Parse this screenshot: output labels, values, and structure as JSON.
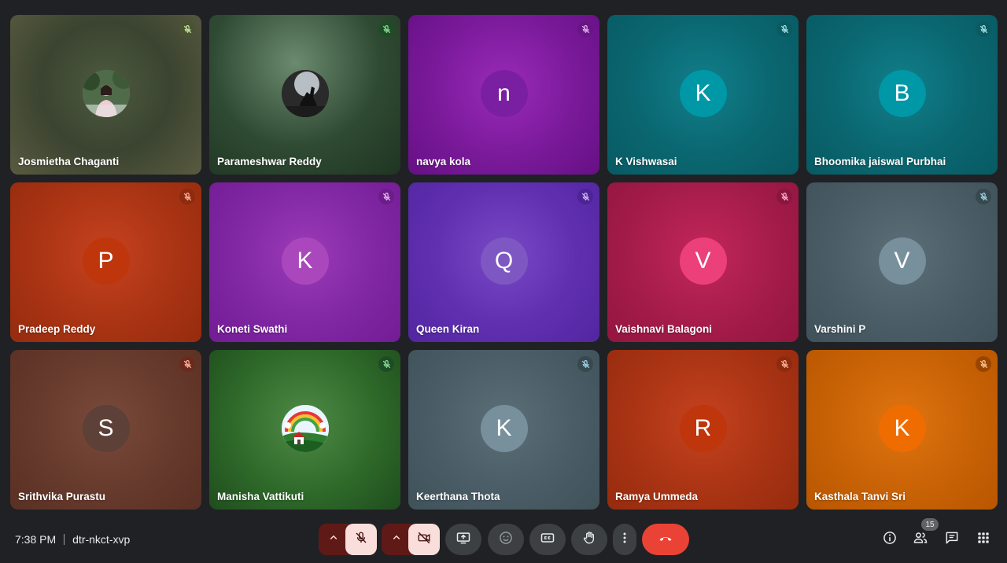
{
  "participants": [
    {
      "name": "Josmietha Chaganti",
      "avatar": "photo-person",
      "initial": "",
      "bg": "radial-gradient(circle at 50% 45%, #4f5a40 0%, #3a4430 50%, #5a5a40 100%)",
      "avatar_bg": "#6b8a6a",
      "badge_bg": "#4a5234",
      "badge_color": "#c9e7a0"
    },
    {
      "name": "Parameshwar Reddy",
      "avatar": "photo-silhouette",
      "initial": "",
      "bg": "radial-gradient(circle at 45% 30%, #6b8a6e 0%, #2f4a33 55%, #1f3522 100%)",
      "avatar_bg": "#333",
      "badge_bg": "#1e4d25",
      "badge_color": "#8fd99b"
    },
    {
      "name": "navya kola",
      "avatar": "letter",
      "initial": "n",
      "bg": "radial-gradient(circle at 50% 45%, #9a2ab8 0%, #7a1a9a 55%, #661085 100%)",
      "avatar_bg": "#7b1fa2",
      "badge_bg": "#6a1585",
      "badge_color": "#e1b6f0"
    },
    {
      "name": "K Vishwasai",
      "avatar": "letter",
      "initial": "K",
      "bg": "radial-gradient(circle at 50% 45%, #117f8a 0%, #0a6670 55%, #085a63 100%)",
      "avatar_bg": "#0097a7",
      "badge_bg": "#0a5a62",
      "badge_color": "#a6e4ec"
    },
    {
      "name": "Bhoomika jaiswal Purbhai",
      "avatar": "letter",
      "initial": "B",
      "bg": "radial-gradient(circle at 50% 45%, #117f8a 0%, #0a6670 55%, #085a63 100%)",
      "avatar_bg": "#0097a7",
      "badge_bg": "#0a5a62",
      "badge_color": "#a6e4ec"
    },
    {
      "name": "Pradeep Reddy",
      "avatar": "letter",
      "initial": "P",
      "bg": "radial-gradient(circle at 50% 45%, #c6421f 0%, #a93414 55%, #962b0e 100%)",
      "avatar_bg": "#bf360c",
      "badge_bg": "#8e2a0d",
      "badge_color": "#ffb59c"
    },
    {
      "name": "Koneti Swathi",
      "avatar": "letter",
      "initial": "K",
      "bg": "radial-gradient(circle at 50% 45%, #9c3bb8 0%, #8027a3 55%, #721c94 100%)",
      "avatar_bg": "#ab47bc",
      "badge_bg": "#6e1c8c",
      "badge_color": "#e6baf2"
    },
    {
      "name": "Queen Kiran",
      "avatar": "letter",
      "initial": "Q",
      "bg": "radial-gradient(circle at 50% 45%, #7a49c6 0%, #5f2fb0 55%, #5226a0 100%)",
      "avatar_bg": "#7e57c2",
      "badge_bg": "#4d2395",
      "badge_color": "#d0bcf7"
    },
    {
      "name": "Vaishnavi Balagoni",
      "avatar": "letter",
      "initial": "V",
      "bg": "radial-gradient(circle at 50% 45%, #c2275a 0%, #a51c4a 55%, #931540 100%)",
      "avatar_bg": "#ec407a",
      "badge_bg": "#8a1640",
      "badge_color": "#ffb1c8"
    },
    {
      "name": "Varshini P",
      "avatar": "letter",
      "initial": "V",
      "bg": "radial-gradient(circle at 50% 45%, #5b6f78 0%, #4a5d66 55%, #3f5159 100%)",
      "avatar_bg": "#78909c",
      "badge_bg": "#37484f",
      "badge_color": "#9fd6ea"
    },
    {
      "name": "Srithvika Purastu",
      "avatar": "letter",
      "initial": "S",
      "bg": "radial-gradient(circle at 50% 45%, #7a4a3a 0%, #663a2c 55%, #5a3024 100%)",
      "avatar_bg": "#5d4037",
      "badge_bg": "#6a2a1e",
      "badge_color": "#ffb59c"
    },
    {
      "name": "Manisha Vattikuti",
      "avatar": "photo-rainbow",
      "initial": "",
      "bg": "radial-gradient(circle at 50% 45%, #4f8a46 0%, #2f6a2a 55%, #1f4d1d 100%)",
      "avatar_bg": "#fff",
      "badge_bg": "#1e4d25",
      "badge_color": "#8fd99b"
    },
    {
      "name": "Keerthana Thota",
      "avatar": "letter",
      "initial": "K",
      "bg": "radial-gradient(circle at 50% 45%, #5b6f78 0%, #4a5d66 55%, #3f5159 100%)",
      "avatar_bg": "#78909c",
      "badge_bg": "#37484f",
      "badge_color": "#9fd6ea"
    },
    {
      "name": "Ramya Ummeda",
      "avatar": "letter",
      "initial": "R",
      "bg": "radial-gradient(circle at 50% 45%, #c6421f 0%, #a93414 55%, #962b0e 100%)",
      "avatar_bg": "#bf360c",
      "badge_bg": "#8e2a0d",
      "badge_color": "#ffb59c"
    },
    {
      "name": "Kasthala Tanvi Sri",
      "avatar": "letter",
      "initial": "K",
      "bg": "radial-gradient(circle at 50% 45%, #e0740f 0%, #c86206 55%, #b85600 100%)",
      "avatar_bg": "#ef6c00",
      "badge_bg": "#994500",
      "badge_color": "#ffc791"
    }
  ],
  "bottom_bar": {
    "time": "7:38 PM",
    "meeting_code": "dtr-nkct-xvp",
    "people_count": "15",
    "colors": {
      "end_call": "#ea4335",
      "muted_bg": "#f9dedc",
      "caret_bg": "#5f1a17",
      "button_bg": "#3c4043"
    },
    "icons": [
      "chevron-up-icon",
      "mic-off-icon",
      "chevron-up-icon",
      "camera-off-icon",
      "present-screen-icon",
      "emoji-icon",
      "captions-icon",
      "raise-hand-icon",
      "more-options-icon",
      "end-call-icon",
      "info-icon",
      "people-icon",
      "chat-icon",
      "activities-icon"
    ]
  }
}
